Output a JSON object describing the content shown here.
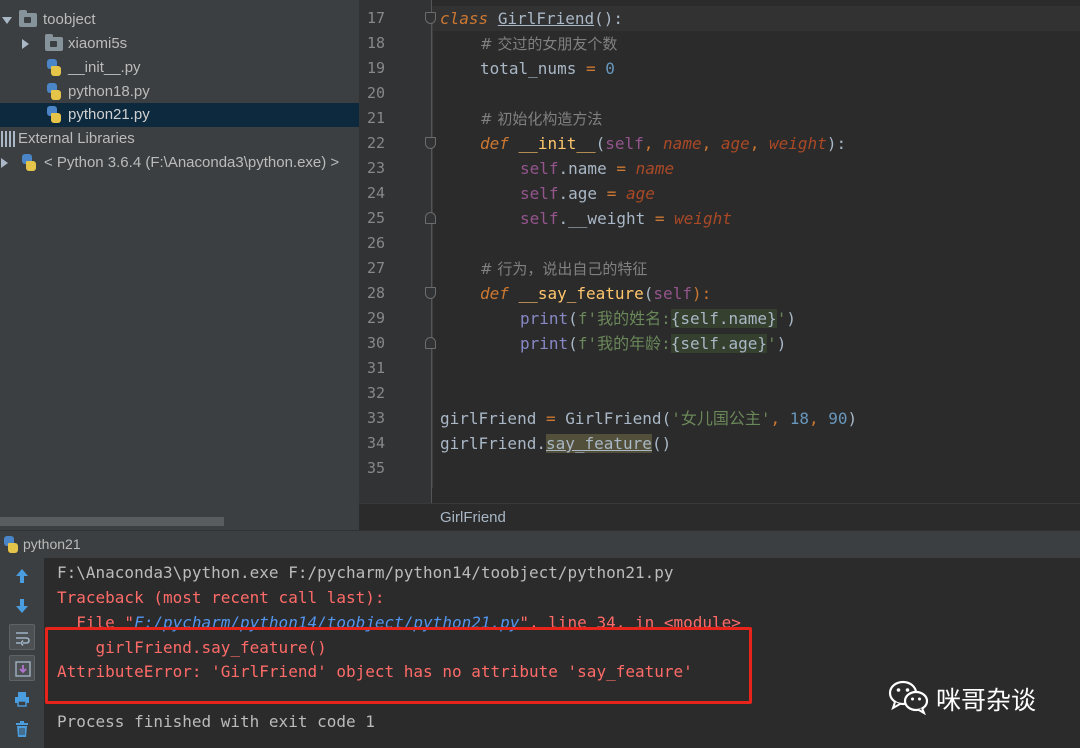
{
  "project_tree": {
    "items": [
      {
        "label": "toobject"
      },
      {
        "label": "xiaomi5s"
      },
      {
        "label": "__init__.py"
      },
      {
        "label": "python18.py"
      },
      {
        "label": "python21.py"
      },
      {
        "label": "External Libraries"
      },
      {
        "label": "< Python 3.6.4 (F:\\Anaconda3\\python.exe) >"
      }
    ]
  },
  "editor": {
    "line_numbers": [
      "17",
      "18",
      "19",
      "20",
      "21",
      "22",
      "23",
      "24",
      "25",
      "26",
      "27",
      "28",
      "29",
      "30",
      "31",
      "32",
      "33",
      "34",
      "35"
    ],
    "code": {
      "l17_kw": "class",
      "l17_name": "GirlFriend",
      "l17_rest": "():",
      "l18_comment": "# 交过的女朋友个数",
      "l19_var": "total_nums",
      "l19_op": " = ",
      "l19_num": "0",
      "l21_comment": "# 初始化构造方法",
      "l22_kw": "def",
      "l22_fn": "__init__",
      "l22_open": "(",
      "l22_self": "self",
      "l22_sep1": ", ",
      "l22_p1": "name",
      "l22_sep2": ", ",
      "l22_p2": "age",
      "l22_sep3": ", ",
      "l22_p3": "weight",
      "l22_close": "):",
      "l23_self": "self",
      "l23_attr": ".name",
      "l23_op": " = ",
      "l23_val": "name",
      "l24_self": "self",
      "l24_attr": ".age",
      "l24_op": " = ",
      "l24_val": "age",
      "l25_self": "self",
      "l25_attr": ".__weight",
      "l25_op": " = ",
      "l25_val": "weight",
      "l27_comment": "# 行为，说出自己的特征",
      "l28_kw": "def",
      "l28_fn": "__say_feature",
      "l28_open": "(",
      "l28_self": "self",
      "l28_close": "):",
      "l29_print": "print",
      "l29_open": "(",
      "l29_str1": "f'我的姓名:",
      "l29_expr": "{self.name}",
      "l29_str2": "'",
      "l29_close": ")",
      "l30_print": "print",
      "l30_open": "(",
      "l30_str1": "f'我的年龄:",
      "l30_expr": "{self.age}",
      "l30_str2": "'",
      "l30_close": ")",
      "l33_var": "girlFriend",
      "l33_op": " = ",
      "l33_call": "GirlFriend(",
      "l33_str": "'女儿国公主'",
      "l33_sep1": ", ",
      "l33_n1": "18",
      "l33_sep2": ", ",
      "l33_n2": "90",
      "l33_close": ")",
      "l34_var": "girlFriend.",
      "l34_method": "say_feature",
      "l34_rest": "()"
    },
    "breadcrumb": "GirlFriend"
  },
  "run_panel": {
    "title": "python21",
    "lines": {
      "cmd": "F:\\Anaconda3\\python.exe F:/pycharm/python14/toobject/python21.py",
      "traceback": "Traceback (most recent call last):",
      "file_prefix": "  File \"",
      "file_link": "F:/pycharm/python14/toobject/python21.py",
      "file_suffix": "\", line 34, in <module>",
      "code": "    girlFriend.say_feature()",
      "error": "AttributeError: 'GirlFriend' object has no attribute 'say_feature'",
      "exit": "Process finished with exit code 1"
    }
  },
  "watermark": {
    "text": "咪哥杂谈",
    "icon": "wechat-icon"
  },
  "colors": {
    "highlight_box": "#e8231a",
    "error_text": "#ff6b68",
    "keyword": "#cc7832",
    "selected_row": "#0d293e"
  }
}
